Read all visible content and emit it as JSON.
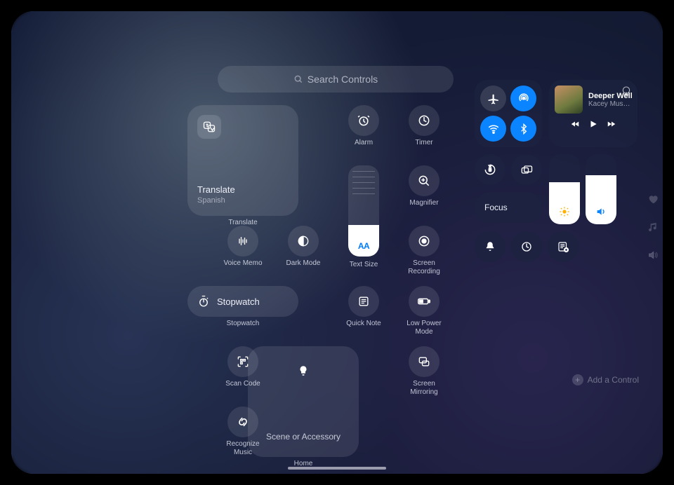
{
  "search": {
    "placeholder": "Search Controls"
  },
  "gallery": {
    "translate": {
      "title": "Translate",
      "sub": "Spanish",
      "label": "Translate"
    },
    "alarm": "Alarm",
    "timer": "Timer",
    "magnifier": "Magnifier",
    "text_size": "Text Size",
    "voice_memo": "Voice Memo",
    "dark_mode": "Dark Mode",
    "screen_recording": "Screen\nRecording",
    "stopwatch_tile": "Stopwatch",
    "stopwatch_label": "Stopwatch",
    "quick_note": "Quick Note",
    "low_power": "Low Power\nMode",
    "scan_code": "Scan Code",
    "home": {
      "label": "Home",
      "body": "Scene or Accessory"
    },
    "screen_mirroring": "Screen\nMirroring",
    "recognize_music": "Recognize\nMusic"
  },
  "cc": {
    "media": {
      "title": "Deeper Well",
      "artist": "Kacey Musgra…"
    },
    "focus": "Focus",
    "brightness_pct": 60,
    "volume_pct": 70,
    "add_control": "Add a Control"
  },
  "text_size_slider_pct": 35,
  "icons": {
    "search": "search-icon",
    "translate": "translate-icon",
    "alarm": "alarm-clock-icon",
    "timer": "timer-icon",
    "magnifier": "magnifying-glass-plus-icon",
    "text_size": "text-size-icon",
    "voice_memo": "waveform-icon",
    "dark_mode": "half-moon-icon",
    "screen_recording": "record-icon",
    "stopwatch": "stopwatch-icon",
    "quick_note": "note-icon",
    "low_power": "battery-icon",
    "scan_code": "qr-scan-icon",
    "home_light": "lightbulb-icon",
    "screen_mirroring": "screen-mirroring-icon",
    "recognize_music": "shazam-icon",
    "airplane": "airplane-icon",
    "airdrop": "airdrop-icon",
    "wifi": "wifi-icon",
    "bluetooth": "bluetooth-icon",
    "airplay": "airplay-icon",
    "rewind": "rewind-icon",
    "play": "play-icon",
    "forward": "forward-icon",
    "orientation_lock": "orientation-lock-icon",
    "stage_manager": "rectangles-icon",
    "brightness": "sun-icon",
    "volume": "speaker-icon",
    "silent": "bell-icon",
    "timer2": "timer-icon",
    "note": "note-add-icon",
    "heart": "heart-icon",
    "music_note": "music-note-icon",
    "speaker_fade": "speaker-icon"
  }
}
